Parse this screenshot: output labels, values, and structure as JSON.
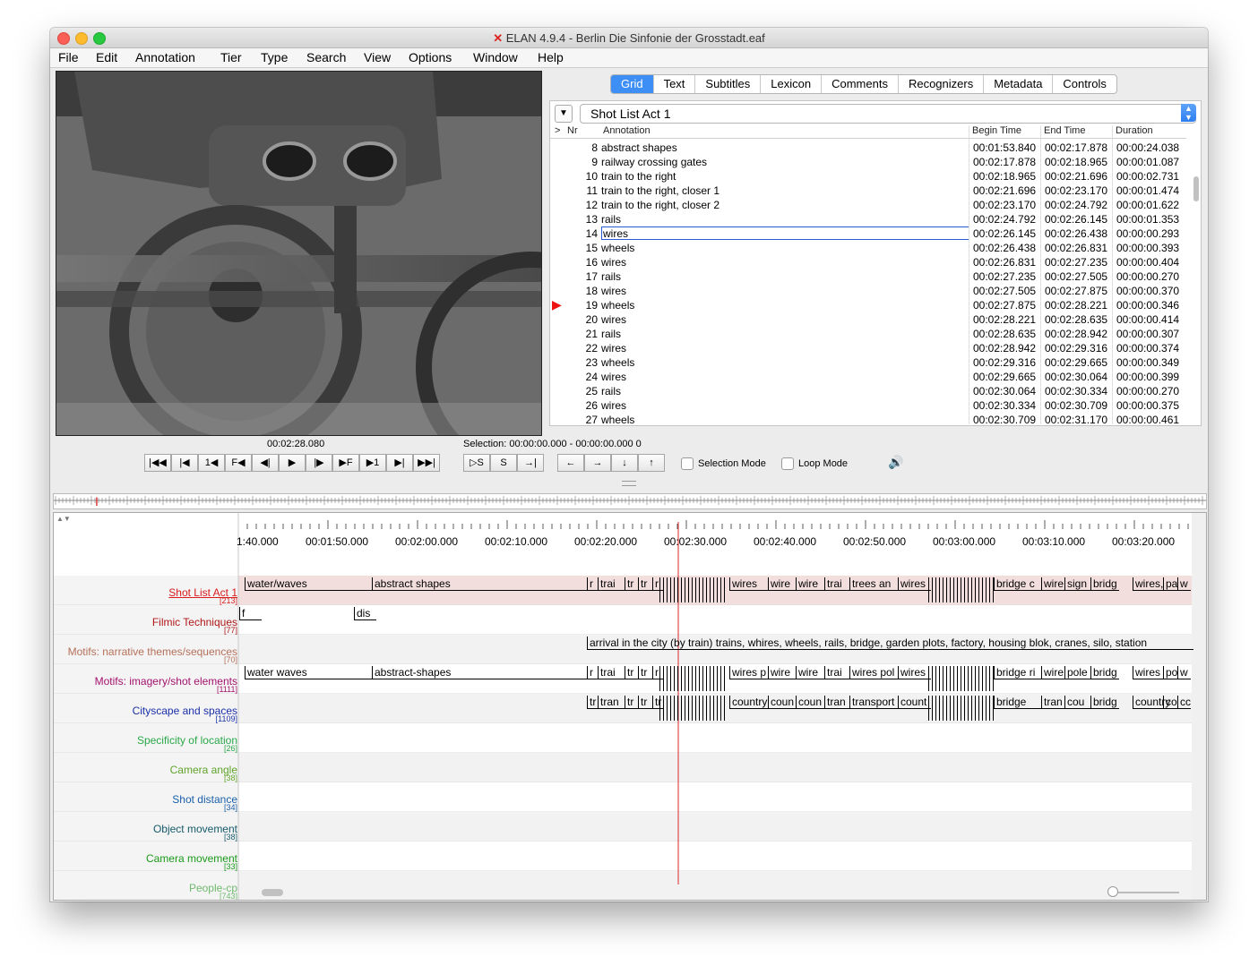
{
  "window": {
    "title": "ELAN 4.9.4 - Berlin Die Sinfonie der Grosstadt.eaf"
  },
  "menu": [
    "File",
    "Edit",
    "Annotation",
    "Tier",
    "Type",
    "Search",
    "View",
    "Options",
    "Window",
    "Help"
  ],
  "tabs": [
    {
      "label": "Grid",
      "active": true
    },
    {
      "label": "Text",
      "active": false
    },
    {
      "label": "Subtitles",
      "active": false
    },
    {
      "label": "Lexicon",
      "active": false
    },
    {
      "label": "Comments",
      "active": false
    },
    {
      "label": "Recognizers",
      "active": false
    },
    {
      "label": "Metadata",
      "active": false
    },
    {
      "label": "Controls",
      "active": false
    }
  ],
  "grid": {
    "tier": "Shot List Act 1",
    "headers": {
      "marker": ">",
      "nr": "Nr",
      "annotation": "Annotation",
      "begin": "Begin Time",
      "end": "End Time",
      "duration": "Duration"
    },
    "rows": [
      {
        "nr": "8",
        "annotation": "abstract shapes",
        "begin": "00:01:53.840",
        "end": "00:02:17.878",
        "duration": "00:00:24.038"
      },
      {
        "nr": "9",
        "annotation": "railway crossing gates",
        "begin": "00:02:17.878",
        "end": "00:02:18.965",
        "duration": "00:00:01.087"
      },
      {
        "nr": "10",
        "annotation": "train to the right",
        "begin": "00:02:18.965",
        "end": "00:02:21.696",
        "duration": "00:00:02.731"
      },
      {
        "nr": "11",
        "annotation": "train to the right, closer 1",
        "begin": "00:02:21.696",
        "end": "00:02:23.170",
        "duration": "00:00:01.474"
      },
      {
        "nr": "12",
        "annotation": "train to the right, closer 2",
        "begin": "00:02:23.170",
        "end": "00:02:24.792",
        "duration": "00:00:01.622"
      },
      {
        "nr": "13",
        "annotation": "rails",
        "begin": "00:02:24.792",
        "end": "00:02:26.145",
        "duration": "00:00:01.353"
      },
      {
        "nr": "14",
        "annotation": "wires",
        "begin": "00:02:26.145",
        "end": "00:02:26.438",
        "duration": "00:00:00.293"
      },
      {
        "nr": "15",
        "annotation": "wheels",
        "begin": "00:02:26.438",
        "end": "00:02:26.831",
        "duration": "00:00:00.393"
      },
      {
        "nr": "16",
        "annotation": "wires",
        "begin": "00:02:26.831",
        "end": "00:02:27.235",
        "duration": "00:00:00.404"
      },
      {
        "nr": "17",
        "annotation": "rails",
        "begin": "00:02:27.235",
        "end": "00:02:27.505",
        "duration": "00:00:00.270"
      },
      {
        "nr": "18",
        "annotation": "wires",
        "begin": "00:02:27.505",
        "end": "00:02:27.875",
        "duration": "00:00:00.370"
      },
      {
        "nr": "19",
        "annotation": "wheels",
        "begin": "00:02:27.875",
        "end": "00:02:28.221",
        "duration": "00:00:00.346"
      },
      {
        "nr": "20",
        "annotation": "wires",
        "begin": "00:02:28.221",
        "end": "00:02:28.635",
        "duration": "00:00:00.414"
      },
      {
        "nr": "21",
        "annotation": "rails",
        "begin": "00:02:28.635",
        "end": "00:02:28.942",
        "duration": "00:00:00.307"
      },
      {
        "nr": "22",
        "annotation": "wires",
        "begin": "00:02:28.942",
        "end": "00:02:29.316",
        "duration": "00:00:00.374"
      },
      {
        "nr": "23",
        "annotation": "wheels",
        "begin": "00:02:29.316",
        "end": "00:02:29.665",
        "duration": "00:00:00.349"
      },
      {
        "nr": "24",
        "annotation": "wires",
        "begin": "00:02:29.665",
        "end": "00:02:30.064",
        "duration": "00:00:00.399"
      },
      {
        "nr": "25",
        "annotation": "rails",
        "begin": "00:02:30.064",
        "end": "00:02:30.334",
        "duration": "00:00:00.270"
      },
      {
        "nr": "26",
        "annotation": "wires",
        "begin": "00:02:30.334",
        "end": "00:02:30.709",
        "duration": "00:00:00.375"
      },
      {
        "nr": "27",
        "annotation": "wheels",
        "begin": "00:02:30.709",
        "end": "00:02:31.170",
        "duration": "00:00:00.461"
      }
    ],
    "selected_nr": "14",
    "current_nr": "19"
  },
  "player": {
    "current_time": "00:02:28.080",
    "selection": "Selection: 00:00:00.000 - 00:00:00.000  0",
    "buttons": [
      "|◀◀",
      "|◀",
      "1◀",
      "F◀",
      "◀|",
      "▶",
      "|▶",
      "▶F",
      "▶1",
      "▶|",
      "▶▶|"
    ],
    "selection_buttons": [
      "▷S",
      "S",
      "→|"
    ],
    "nav_buttons": [
      "←",
      "→",
      "↓",
      "↑"
    ],
    "selection_mode_label": "Selection Mode",
    "loop_mode_label": "Loop Mode"
  },
  "ruler": {
    "labels": [
      "1:40.000",
      "00:01:50.000",
      "00:02:00.000",
      "00:02:10.000",
      "00:02:20.000",
      "00:02:30.000",
      "00:02:40.000",
      "00:02:50.000",
      "00:03:00.000",
      "00:03:10.000",
      "00:03:20.000"
    ]
  },
  "tiers": [
    {
      "name": "Shot List Act 1",
      "count": "[213]",
      "color": "#d81b1b",
      "active": true
    },
    {
      "name": "Filmic Techniques",
      "count": "[77]",
      "color": "#b01818"
    },
    {
      "name": "Motifs: narrative themes/sequences",
      "count": "[70]",
      "color": "#b5705a"
    },
    {
      "name": "Motifs: imagery/shot elements",
      "count": "[1111]",
      "color": "#a3136e"
    },
    {
      "name": "Cityscape and spaces",
      "count": "[1109]",
      "color": "#1a2fa8"
    },
    {
      "name": "Specificity of location",
      "count": "[26]",
      "color": "#2aa84a"
    },
    {
      "name": "Camera angle",
      "count": "[38]",
      "color": "#5fa32a"
    },
    {
      "name": "Shot distance",
      "count": "[34]",
      "color": "#1a5fa8"
    },
    {
      "name": "Object movement",
      "count": "[38]",
      "color": "#155a6b"
    },
    {
      "name": "Camera movement",
      "count": "[33]",
      "color": "#1a9a1a"
    },
    {
      "name": "People-cp",
      "count": "[743]",
      "color": "#6fba6f"
    }
  ],
  "tier_annotations": {
    "shot": [
      "water/waves",
      "abstract shapes",
      "r",
      "trai",
      "tr",
      "tr",
      "r",
      "wires",
      "wire",
      "wire",
      "trai",
      "trees an",
      "wires",
      "bridge c",
      "wire",
      "sign",
      "bridg",
      "wires, l",
      "pa",
      "w"
    ],
    "filmic": [
      "f",
      "dis"
    ],
    "narrative": [
      "arrival in the city (by train) trains, whires, wheels, rails, bridge, garden plots, factory, housing blok, cranes, silo, station"
    ],
    "imagery": [
      "water waves",
      "abstract-shapes",
      "r",
      "trai",
      "tr",
      "tr",
      "r",
      "wires p",
      "wire",
      "wire",
      "trai",
      "wires pol",
      "wires",
      "bridge ri",
      "wire",
      "pole",
      "bridg",
      "wires p",
      "pol",
      "w"
    ],
    "cityscape": [
      "tr",
      "tran",
      "tr",
      "tr",
      "tr",
      "country",
      "coun",
      "coun",
      "tran",
      "transport",
      "count",
      "bridge",
      "tran",
      "cou",
      "bridg",
      "country",
      "co",
      "cc"
    ]
  }
}
